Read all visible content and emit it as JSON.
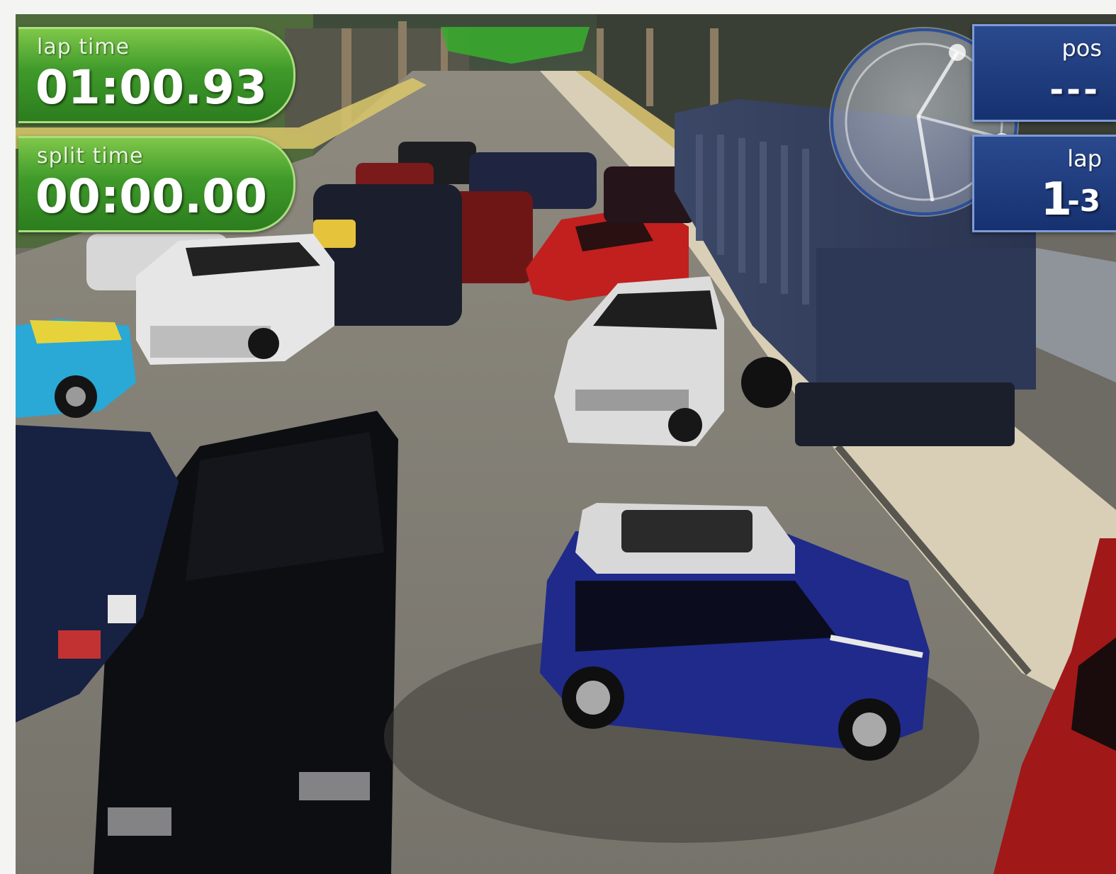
{
  "hud": {
    "lap_time": {
      "label": "lap time",
      "value": "01:00.93"
    },
    "split_time": {
      "label": "split time",
      "value": "00:00.00"
    },
    "position": {
      "label": "pos",
      "value": "---"
    },
    "lap": {
      "label": "lap",
      "current": "1",
      "total": "-3"
    }
  },
  "minimap": {
    "player_marker_icon": "player-dot-icon",
    "track_icon": "track-outline-icon"
  },
  "colors": {
    "hud_green": "#3f9a2a",
    "hud_blue": "#163170",
    "player_car": "#1f2a8a",
    "sign_green": "#39a82e"
  }
}
